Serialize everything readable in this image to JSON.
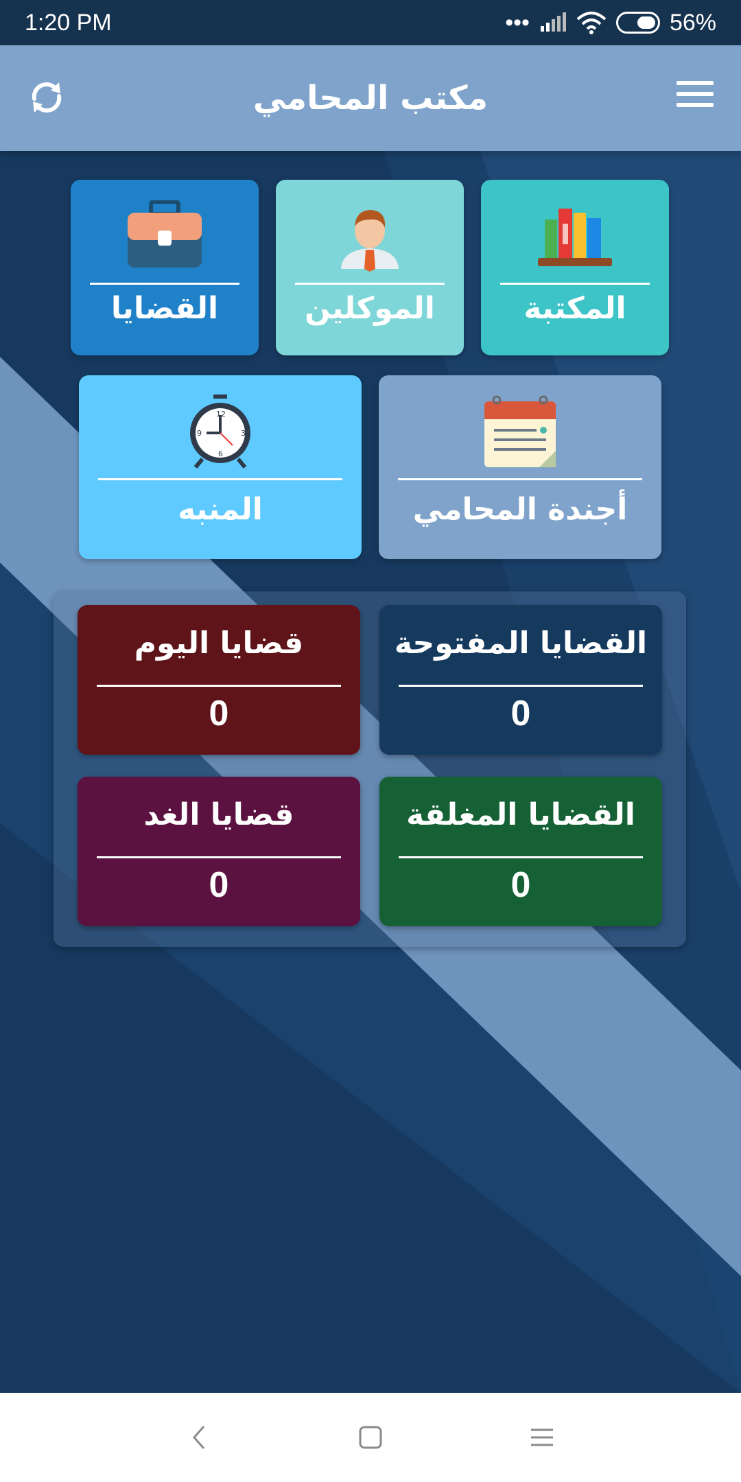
{
  "status_bar": {
    "time": "1:20 PM",
    "battery": "56%"
  },
  "header": {
    "title": "مكتب المحامي",
    "refresh_icon": "refresh-icon",
    "menu_icon": "hamburger-menu-icon"
  },
  "tiles_row1": [
    {
      "label": "القضايا",
      "icon": "briefcase-icon",
      "color": "#1f82c9"
    },
    {
      "label": "الموكلين",
      "icon": "client-avatar-icon",
      "color": "#7ed6d8"
    },
    {
      "label": "المكتبة",
      "icon": "books-icon",
      "color": "#3cc4c6"
    }
  ],
  "tiles_row2": [
    {
      "label": "المنبه",
      "icon": "alarm-clock-icon",
      "color": "#5ecaff"
    },
    {
      "label": "أجندة المحامي",
      "icon": "calendar-notepad-icon",
      "color": "#7fa3cb"
    }
  ],
  "stats": [
    {
      "title": "قضايا اليوم",
      "value": "0",
      "color": "#5e1418"
    },
    {
      "title": "القضايا المفتوحة",
      "value": "0",
      "color": "#153a5e"
    },
    {
      "title": "قضايا الغد",
      "value": "0",
      "color": "#5c1240"
    },
    {
      "title": "القضايا المغلقة",
      "value": "0",
      "color": "#156035"
    }
  ]
}
